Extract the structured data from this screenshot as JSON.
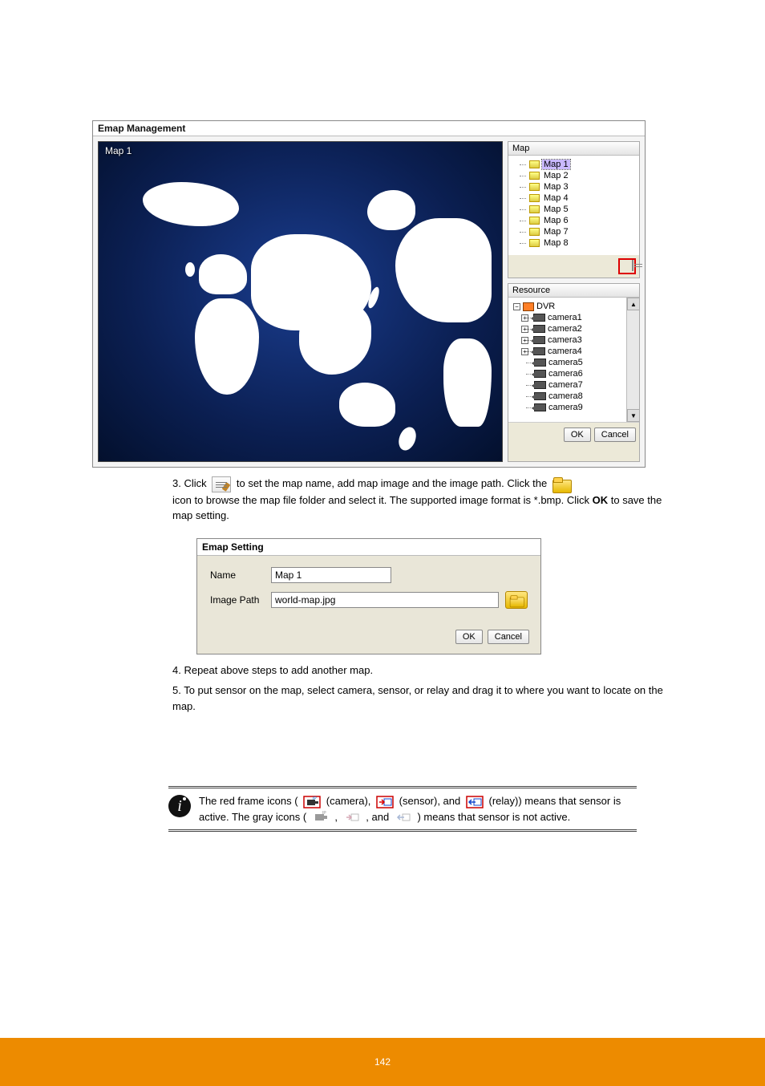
{
  "emap_window": {
    "title": "Emap Management",
    "map_caption": "Map 1",
    "map_panel_header": "Map",
    "map_items": [
      "Map 1",
      "Map 2",
      "Map 3",
      "Map 4",
      "Map 5",
      "Map 6",
      "Map 7",
      "Map 8"
    ],
    "resource_panel_header": "Resource",
    "resource_root": "DVR",
    "cameras": [
      "camera1",
      "camera2",
      "camera3",
      "camera4",
      "camera5",
      "camera6",
      "camera7",
      "camera8",
      "camera9"
    ],
    "ok": "OK",
    "cancel": "Cancel"
  },
  "instructions": {
    "step3_a": "3. Click ",
    "step3_b": " to set the map name, add map image and the image path. Click the ",
    "step3_c": "icon to browse the map file folder and select it. The supported image format is *.bmp. Click ",
    "step3_ok": "OK",
    "step3_d": " to save the map setting."
  },
  "emap_setting": {
    "title": "Emap Setting",
    "name_label": "Name",
    "name_value": "Map 1",
    "path_label": "Image Path",
    "path_value": "world-map.jpg",
    "ok": "OK",
    "cancel": "Cancel"
  },
  "post_text": {
    "step4": "4. Repeat above steps to add another map.",
    "step5_a": "5. To put sensor on the map, select camera, sensor, or relay and drag it to where you want to locate on the map.",
    "note_a": "The red frame icons (",
    "note_b": "(camera), ",
    "note_c": "(sensor), and ",
    "note_d": "(relay)) means that sensor is active. The gray icons (",
    "note_e": ", ",
    "note_f": ", and",
    "note_g": ") means that sensor is not active."
  },
  "footer": {
    "page": "142"
  }
}
